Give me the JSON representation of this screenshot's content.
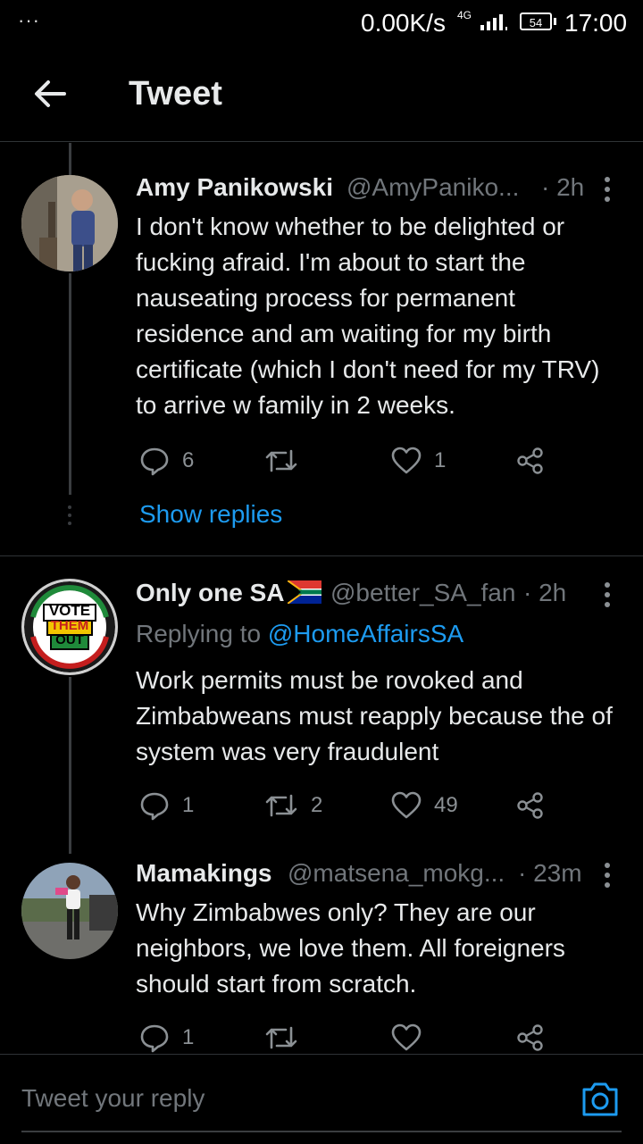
{
  "status_bar": {
    "dots": "···",
    "net_speed": "0.00K/s",
    "network_type": "4G",
    "battery": "54",
    "time": "17:00"
  },
  "header": {
    "title": "Tweet",
    "back_icon": "arrow-left-icon"
  },
  "tweets": [
    {
      "name": "Amy Panikowski",
      "handle": "@AmyPaniko...",
      "time": "· 2h",
      "text": "I don't know whether to be delighted or fucking afraid. I'm about to start the nauseating process for permanent residence and am waiting for my birth certificate (which I don't need for my TRV) to arrive w family in 2 weeks.",
      "replies": "6",
      "retweets": "",
      "likes": "1"
    },
    {
      "name": "Only one SA",
      "flag_icon": "south-africa-flag-icon",
      "handle": "@better_SA_fan",
      "time": "· 2h",
      "replying_prefix": "Replying to",
      "replying_to": "@HomeAffairsSA",
      "avatar_text": {
        "line1": "VOTE",
        "line2": "THEM",
        "line3": "OUT"
      },
      "text": "Work permits must be rovoked and Zimbabweans must reapply because the of system was very fraudulent",
      "replies": "1",
      "retweets": "2",
      "likes": "49"
    },
    {
      "name": "Mamakings",
      "handle": "@matsena_mokg...",
      "time": "· 23m",
      "text": "Why Zimbabwes only? They are our neighbors, we love them. All foreigners should start from scratch.",
      "replies": "1",
      "retweets": "",
      "likes": ""
    }
  ],
  "show_replies": "Show replies",
  "reply_bar": {
    "placeholder": "Tweet your reply",
    "camera_icon": "camera-icon"
  },
  "colors": {
    "background": "#000000",
    "accent": "#1d9bf0",
    "muted": "#71767b",
    "text": "#e7e9ea"
  }
}
